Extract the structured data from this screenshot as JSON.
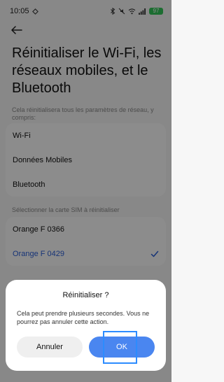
{
  "status_bar": {
    "time": "10:05",
    "battery": "97",
    "icons": [
      "bluetooth-icon",
      "mute-icon",
      "wifi-icon",
      "signal-icon",
      "battery-icon"
    ]
  },
  "page": {
    "title": "Réinitialiser le Wi-Fi, les réseaux mobiles, et le Bluetooth",
    "reset_caption": "Cela réinitialisera tous les paramètres de réseau, y compris:",
    "reset_items": [
      "Wi-Fi",
      "Données Mobiles",
      "Bluetooth"
    ],
    "sim_caption": "Sélectionner la carte SIM à réinitialiser",
    "sim_options": [
      {
        "label": "Orange F 0366",
        "selected": false
      },
      {
        "label": "Orange F 0429",
        "selected": true
      }
    ]
  },
  "dialog": {
    "title": "Réinitialiser ?",
    "body": "Cela peut prendre plusieurs secondes. Vous ne pourrez pas annuler cette action.",
    "cancel_label": "Annuler",
    "ok_label": "OK"
  },
  "colors": {
    "accent": "#4a86f0",
    "selected_text": "#2b5fd9",
    "highlight_border": "#2d8cff"
  }
}
